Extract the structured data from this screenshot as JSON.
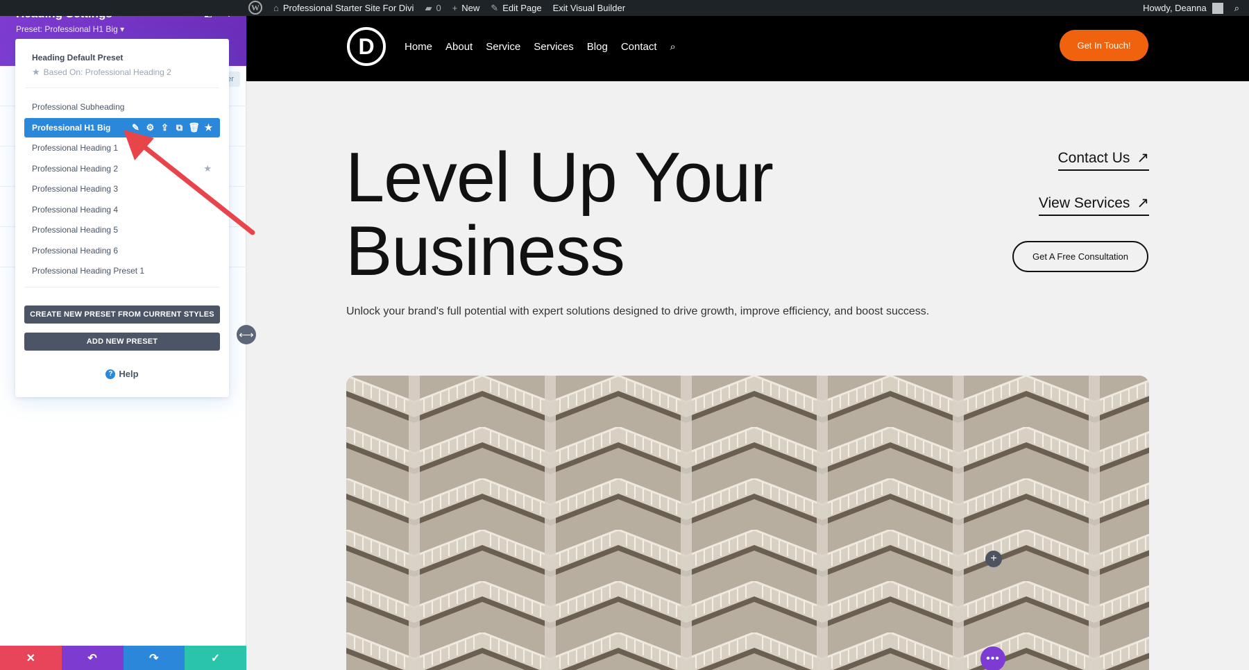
{
  "adminbar": {
    "site_name": "Professional Starter Site For Divi",
    "comments_count": "0",
    "new_label": "New",
    "edit_page_label": "Edit Page",
    "exit_builder_label": "Exit Visual Builder",
    "greeting": "Howdy, Deanna",
    "wp_logo_glyph": "W"
  },
  "panel": {
    "title": "Heading Settings",
    "preset_label": "Preset: Professional H1 Big ▾",
    "filter_stub": "er",
    "colors": {
      "header": "#7e3bd0",
      "active_item": "#2b87da",
      "button_bg": "#4b5566"
    }
  },
  "dropdown": {
    "default_preset": "Heading Default Preset",
    "based_on": "Based On: Professional Heading 2",
    "items": [
      {
        "label": "Professional Subheading"
      },
      {
        "label": "Professional H1 Big",
        "active": true
      },
      {
        "label": "Professional Heading 1"
      },
      {
        "label": "Professional Heading 2",
        "favorite": true
      },
      {
        "label": "Professional Heading 3"
      },
      {
        "label": "Professional Heading 4"
      },
      {
        "label": "Professional Heading 5"
      },
      {
        "label": "Professional Heading 6"
      },
      {
        "label": "Professional Heading Preset 1"
      }
    ],
    "active_actions": [
      "pencil-icon",
      "gear-icon",
      "export-icon",
      "duplicate-icon",
      "trash-icon",
      "star-icon"
    ],
    "create_button": "CREATE NEW PRESET FROM CURRENT STYLES",
    "add_button": "ADD NEW PRESET",
    "help_label": "Help"
  },
  "bottombar": {
    "buttons": [
      {
        "name": "cancel",
        "glyph": "✕",
        "color": "#e8445a"
      },
      {
        "name": "undo",
        "glyph": "↶",
        "color": "#7e3bd0"
      },
      {
        "name": "redo",
        "glyph": "↷",
        "color": "#2b87da"
      },
      {
        "name": "save",
        "glyph": "✓",
        "color": "#29c4a9"
      }
    ]
  },
  "site": {
    "logo_letter": "D",
    "nav": [
      "Home",
      "About",
      "Service",
      "Services",
      "Blog",
      "Contact"
    ],
    "cta": "Get In Touch!",
    "cta_color": "#f0620d",
    "hero_title": "Level Up Your Business",
    "hero_subtitle": "Unlock your brand's full potential with expert solutions designed to drive growth, improve efficiency, and boost success.",
    "contact_link": "Contact Us",
    "services_link": "View Services",
    "consult_button": "Get A Free Consultation",
    "link_arrow": "↗"
  }
}
